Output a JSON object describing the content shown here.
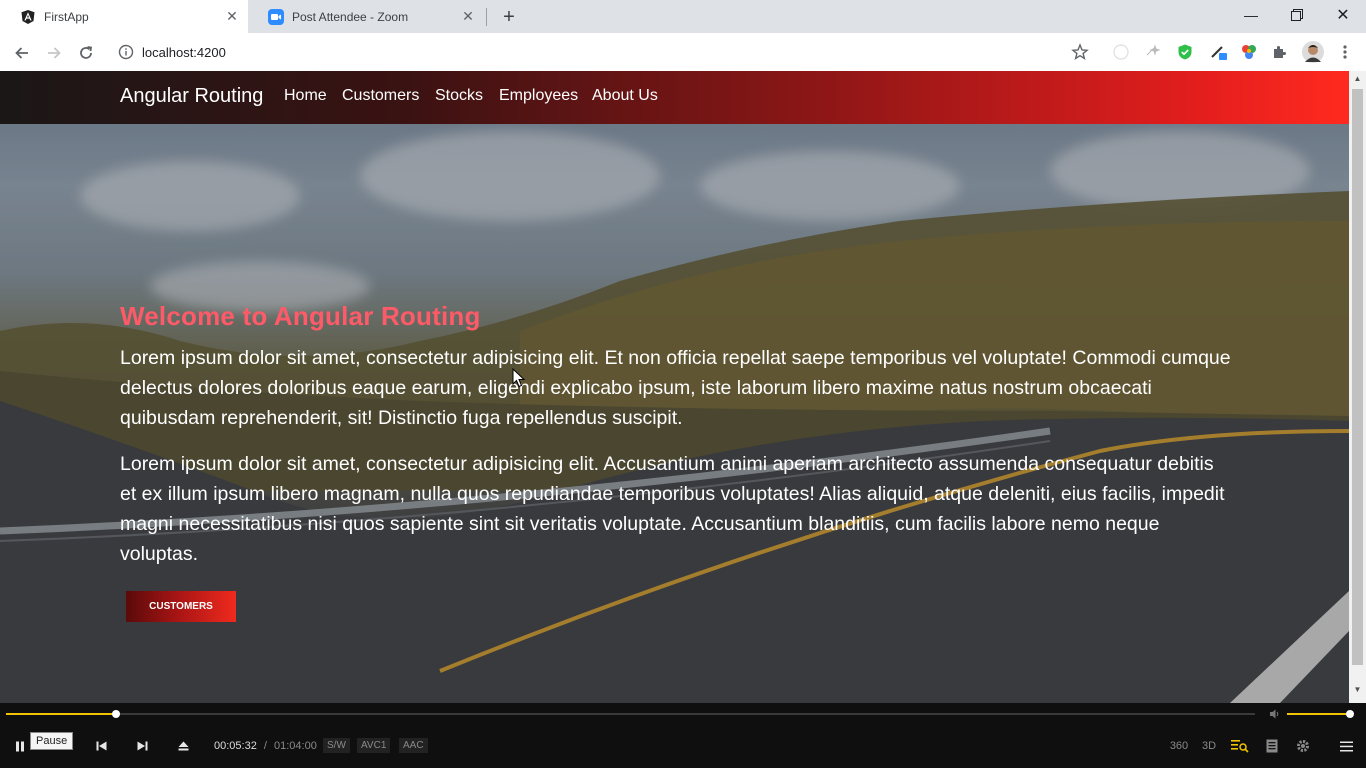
{
  "browser": {
    "tabs": [
      {
        "title": "FirstApp",
        "icon": "angular-icon",
        "active": true
      },
      {
        "title": "Post Attendee - Zoom",
        "icon": "zoom-icon",
        "active": false
      }
    ],
    "url": "localhost:4200"
  },
  "page": {
    "brand": "Angular Routing",
    "nav": [
      "Home",
      "Customers",
      "Stocks",
      "Employees",
      "About Us"
    ],
    "heading": "Welcome to Angular Routing",
    "para1": "Lorem ipsum dolor sit amet, consectetur adipisicing elit. Et non officia repellat saepe temporibus vel voluptate! Commodi cumque delectus dolores doloribus eaque earum, eligendi explicabo ipsum, iste laborum libero maxime natus nostrum obcaecati quibusdam reprehenderit, sit! Distinctio fuga repellendus suscipit.",
    "para2": "Lorem ipsum dolor sit amet, consectetur adipisicing elit. Accusantium animi aperiam architecto assumenda consequatur debitis et ex illum ipsum libero magnam, nulla quos repudiandae temporibus voluptates! Alias aliquid, atque deleniti, eius facilis, impedit magni necessitatibus nisi quos sapiente sint sit veritatis voluptate. Accusantium blanditiis, cum facilis labore nemo neque voluptas.",
    "cta": "CUSTOMERS"
  },
  "player": {
    "tooltip": "Pause",
    "current_time": "00:05:32",
    "separator": "/",
    "duration": "01:04:00",
    "badges": [
      "S/W",
      "AVC1",
      "AAC"
    ],
    "icons_right": [
      "360",
      "3D"
    ],
    "progress_fraction": 0.088,
    "volume_fraction": 1.0,
    "accent_color": "#f2c300"
  }
}
